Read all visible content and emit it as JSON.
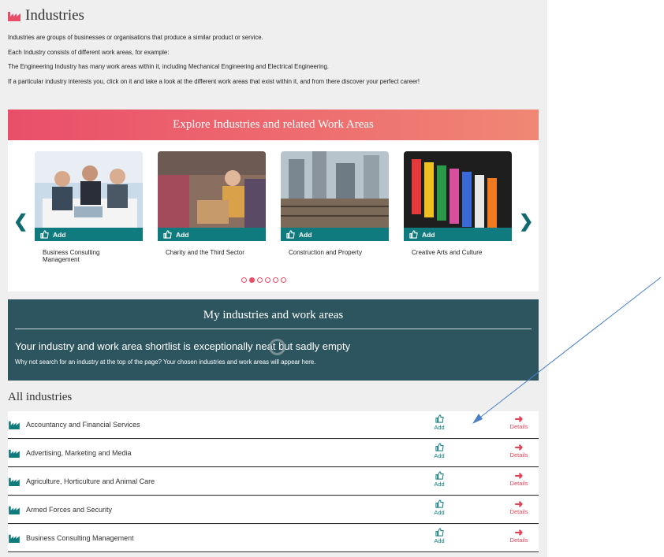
{
  "page": {
    "title": "Industries",
    "intro": [
      "Industries are groups of businesses or organisations that produce a similar product or service.",
      "Each Industry consists of different work areas, for example:",
      "The Engineering Industry has many work areas within it, including Mechanical Engineering and Electrical Engineering.",
      "If a particular industry interests you, click on it and take a look at the different work areas that exist within it, and from there discover your perfect career!"
    ]
  },
  "explore": {
    "banner": "Explore Industries and related Work Areas",
    "add_label": "Add",
    "cards": [
      {
        "name": "Business Consulting Management"
      },
      {
        "name": "Charity and the Third Sector"
      },
      {
        "name": "Construction and Property"
      },
      {
        "name": "Creative Arts and Culture"
      }
    ],
    "dots_total": 6,
    "dots_active": 2
  },
  "my_panel": {
    "title": "My industries and work areas",
    "heading": "Your industry and work area shortlist is exceptionally neat but sadly empty",
    "subtext": "Why not search for an industry at the top of the page? Your chosen industries and work areas will appear here."
  },
  "all_industries": {
    "title": "All industries",
    "add_label": "Add",
    "details_label": "Details",
    "items": [
      "Accountancy and Financial Services",
      "Advertising, Marketing and Media",
      "Agriculture, Horticulture and Animal Care",
      "Armed Forces and Security",
      "Business Consulting Management"
    ]
  },
  "icons": {
    "industry": "factory-icon",
    "add": "thumbs-up-icon",
    "details": "arrow-right-icon",
    "prev": "chevron-left-icon",
    "next": "chevron-right-icon"
  },
  "colors": {
    "teal": "#107b7e",
    "pink": "#e94e69",
    "panel": "#2d5560",
    "details_red": "#e04357",
    "annotation_arrow": "#4a7fc8"
  }
}
